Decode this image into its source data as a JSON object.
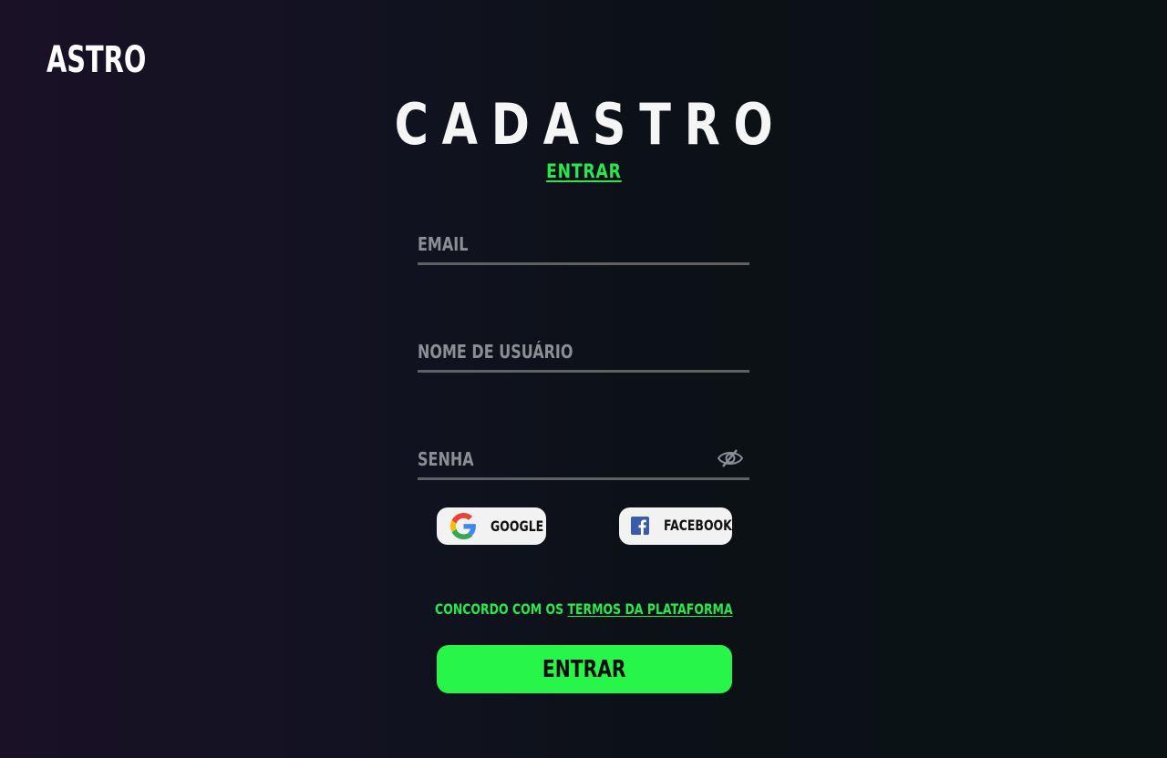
{
  "brand": {
    "logo": "ASTRO"
  },
  "page": {
    "title": "CADASTRO",
    "alt_link": "ENTRAR"
  },
  "form": {
    "email_placeholder": "EMAIL",
    "username_placeholder": "NOME DE USUÁRIO",
    "password_placeholder": "SENHA"
  },
  "social": {
    "google_label": "GOOGLE",
    "facebook_label": "FACEBOOK"
  },
  "terms": {
    "prefix": "CONCORDO COM OS ",
    "link": "TERMOS DA PLATAFORMA"
  },
  "submit_label": "ENTRAR",
  "colors": {
    "accent": "#27f54a",
    "background": "#0c1117",
    "field_line": "#5f6163",
    "placeholder": "#8c8e94",
    "social_bg": "#f2f2f2",
    "facebook_blue": "#3a5ca8"
  },
  "icons": {
    "password_toggle": "eye-slash-icon",
    "google": "google-logo-icon",
    "facebook": "facebook-logo-icon"
  }
}
